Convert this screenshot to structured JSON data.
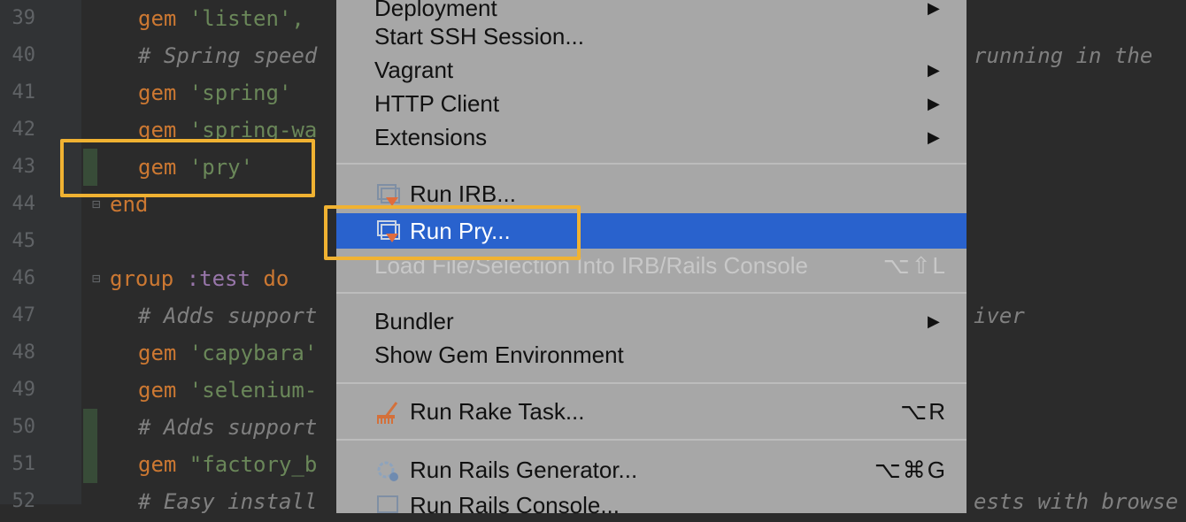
{
  "editor": {
    "lines": [
      {
        "num": "39",
        "parts": [
          [
            "kw",
            "gem "
          ],
          [
            "str",
            "'listen', "
          ]
        ]
      },
      {
        "num": "40",
        "parts": [
          [
            "cmt",
            "# Spring speed"
          ]
        ],
        "right": "running in the"
      },
      {
        "num": "41",
        "parts": [
          [
            "kw",
            "gem "
          ],
          [
            "str",
            "'spring'"
          ]
        ]
      },
      {
        "num": "42",
        "parts": [
          [
            "kw",
            "gem "
          ],
          [
            "str",
            "'spring-wa"
          ]
        ]
      },
      {
        "num": "43",
        "parts": [
          [
            "kw",
            "gem "
          ],
          [
            "str",
            "'pry'"
          ]
        ]
      },
      {
        "num": "44",
        "parts": [
          [
            "kw",
            "end"
          ]
        ]
      },
      {
        "num": "45",
        "parts": []
      },
      {
        "num": "46",
        "parts": [
          [
            "kw",
            "group "
          ],
          [
            "sym",
            ":test "
          ],
          [
            "kw",
            "do"
          ]
        ]
      },
      {
        "num": "47",
        "parts": [
          [
            "cmt",
            "# Adds support"
          ]
        ],
        "right": "iver"
      },
      {
        "num": "48",
        "parts": [
          [
            "kw",
            "gem "
          ],
          [
            "str",
            "'capybara'"
          ]
        ]
      },
      {
        "num": "49",
        "parts": [
          [
            "kw",
            "gem "
          ],
          [
            "str",
            "'selenium-"
          ]
        ]
      },
      {
        "num": "50",
        "parts": [
          [
            "cmt",
            "# Adds support"
          ]
        ]
      },
      {
        "num": "51",
        "parts": [
          [
            "kw",
            "gem "
          ],
          [
            "str",
            "\"factory_b"
          ]
        ]
      },
      {
        "num": "52",
        "parts": [
          [
            "cmt",
            "# Easy install"
          ]
        ],
        "right": "ests with browse"
      }
    ]
  },
  "menu": {
    "items": [
      {
        "label": "Deployment",
        "submenu": true
      },
      {
        "label": "Start SSH Session..."
      },
      {
        "label": "Vagrant",
        "submenu": true
      },
      {
        "label": "HTTP Client",
        "submenu": true
      },
      {
        "label": "Extensions",
        "submenu": true
      },
      {
        "label": "Run IRB...",
        "icon": "irb-console-icon"
      },
      {
        "label": "Run Pry...",
        "icon": "pry-console-icon",
        "selected": true
      },
      {
        "label": "Load File/Selection Into IRB/Rails Console",
        "shortcut": "⌥⇧L",
        "disabled": true
      },
      {
        "label": "Bundler",
        "submenu": true
      },
      {
        "label": "Show Gem Environment"
      },
      {
        "label": "Run Rake Task...",
        "shortcut": "⌥R",
        "icon": "rake-icon"
      },
      {
        "label": "Run Rails Generator...",
        "shortcut": "⌥⌘G",
        "icon": "rails-generator-icon"
      },
      {
        "label": "Run Rails Console...",
        "icon": "rails-console-icon"
      }
    ],
    "submenu_arrow": "▶"
  },
  "colors": {
    "editor_bg": "#2b2b2b",
    "menu_bg": "#a7a7a7",
    "selection": "#2962cd",
    "highlight": "#f0b232"
  }
}
